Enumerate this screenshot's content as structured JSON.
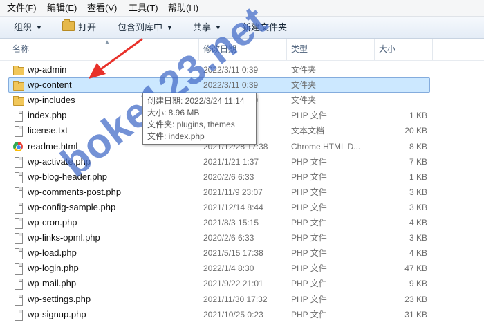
{
  "menu": {
    "file": "文件(F)",
    "edit": "编辑(E)",
    "view": "查看(V)",
    "tools": "工具(T)",
    "help": "帮助(H)"
  },
  "toolbar": {
    "organize": "组织",
    "open": "打开",
    "include_library": "包含到库中",
    "share": "共享",
    "new_folder": "新建文件夹"
  },
  "columns": {
    "name": "名称",
    "date": "修改日期",
    "type": "类型",
    "size": "大小"
  },
  "files": [
    {
      "name": "wp-admin",
      "date": "2022/3/11 0:39",
      "type": "文件夹",
      "size": "",
      "icon": "folder-icon"
    },
    {
      "name": "wp-content",
      "date": "2022/3/11 0:39",
      "type": "文件夹",
      "size": "",
      "icon": "folder-icon"
    },
    {
      "name": "wp-includes",
      "date": "2022/3/11 0:39",
      "type": "文件夹",
      "size": "",
      "icon": "folder-icon"
    },
    {
      "name": "index.php",
      "date": "2020/2/6 6:33",
      "type": "PHP 文件",
      "size": "1 KB",
      "icon": "file-icon"
    },
    {
      "name": "license.txt",
      "date": "2022/1/1 0:46",
      "type": "文本文档",
      "size": "20 KB",
      "icon": "file-icon"
    },
    {
      "name": "readme.html",
      "date": "2021/12/28 17:38",
      "type": "Chrome HTML D...",
      "size": "8 KB",
      "icon": "chrome-icon"
    },
    {
      "name": "wp-activate.php",
      "date": "2021/1/21 1:37",
      "type": "PHP 文件",
      "size": "7 KB",
      "icon": "file-icon"
    },
    {
      "name": "wp-blog-header.php",
      "date": "2020/2/6 6:33",
      "type": "PHP 文件",
      "size": "1 KB",
      "icon": "file-icon"
    },
    {
      "name": "wp-comments-post.php",
      "date": "2021/11/9 23:07",
      "type": "PHP 文件",
      "size": "3 KB",
      "icon": "file-icon"
    },
    {
      "name": "wp-config-sample.php",
      "date": "2021/12/14 8:44",
      "type": "PHP 文件",
      "size": "3 KB",
      "icon": "file-icon"
    },
    {
      "name": "wp-cron.php",
      "date": "2021/8/3 15:15",
      "type": "PHP 文件",
      "size": "4 KB",
      "icon": "file-icon"
    },
    {
      "name": "wp-links-opml.php",
      "date": "2020/2/6 6:33",
      "type": "PHP 文件",
      "size": "3 KB",
      "icon": "file-icon"
    },
    {
      "name": "wp-load.php",
      "date": "2021/5/15 17:38",
      "type": "PHP 文件",
      "size": "4 KB",
      "icon": "file-icon"
    },
    {
      "name": "wp-login.php",
      "date": "2022/1/4 8:30",
      "type": "PHP 文件",
      "size": "47 KB",
      "icon": "file-icon"
    },
    {
      "name": "wp-mail.php",
      "date": "2021/9/22 21:01",
      "type": "PHP 文件",
      "size": "9 KB",
      "icon": "file-icon"
    },
    {
      "name": "wp-settings.php",
      "date": "2021/11/30 17:32",
      "type": "PHP 文件",
      "size": "23 KB",
      "icon": "file-icon"
    },
    {
      "name": "wp-signup.php",
      "date": "2021/10/25 0:23",
      "type": "PHP 文件",
      "size": "31 KB",
      "icon": "file-icon"
    }
  ],
  "selected_index": 1,
  "tooltip": {
    "created": "创建日期: 2022/3/24 11:14",
    "size": "大小: 8.96 MB",
    "folders": "文件夹: plugins, themes",
    "files": "文件: index.php"
  },
  "watermark": "boke123.net",
  "colors": {
    "selection": "#cce8ff",
    "selection_border": "#84acdd",
    "arrow": "#e8312a",
    "watermark": "#466ec8"
  }
}
